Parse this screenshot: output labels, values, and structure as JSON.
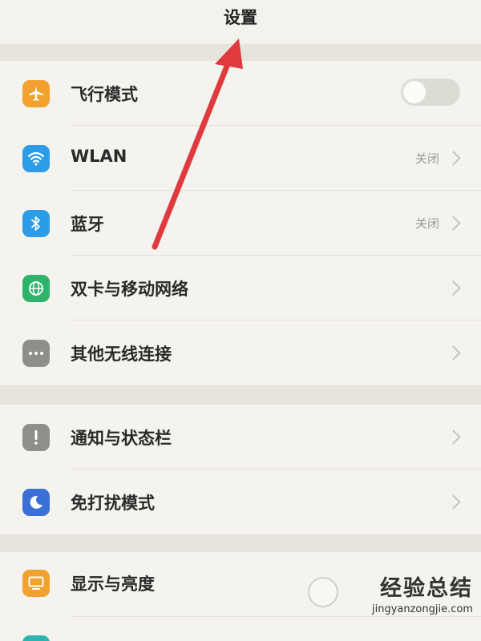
{
  "header": {
    "title": "设置"
  },
  "group1": {
    "items": [
      {
        "label": "飞行模式",
        "icon": "airplane-icon",
        "icon_color": "#f0a12e",
        "toggle": "off"
      },
      {
        "label": "WLAN",
        "icon": "wifi-icon",
        "icon_color": "#2c9be8",
        "status": "关闭"
      },
      {
        "label": "蓝牙",
        "icon": "bluetooth-icon",
        "icon_color": "#2c9be8",
        "status": "关闭"
      },
      {
        "label": "双卡与移动网络",
        "icon": "globe-icon",
        "icon_color": "#2eb36a"
      },
      {
        "label": "其他无线连接",
        "icon": "more-dots-icon",
        "icon_color": "#8e8e8a"
      }
    ]
  },
  "group2": {
    "items": [
      {
        "label": "通知与状态栏",
        "icon": "exclamation-icon",
        "icon_color": "#8e8e8a"
      },
      {
        "label": "免打扰模式",
        "icon": "moon-icon",
        "icon_color": "#3b6fd8"
      }
    ]
  },
  "group3": {
    "items": [
      {
        "label": "显示与亮度",
        "icon": "display-icon",
        "icon_color": "#f0a12e"
      }
    ]
  },
  "annotation": {
    "color": "#e0393e"
  },
  "watermark": {
    "title": "经验总结",
    "url": "jingyanzongjie.com"
  }
}
